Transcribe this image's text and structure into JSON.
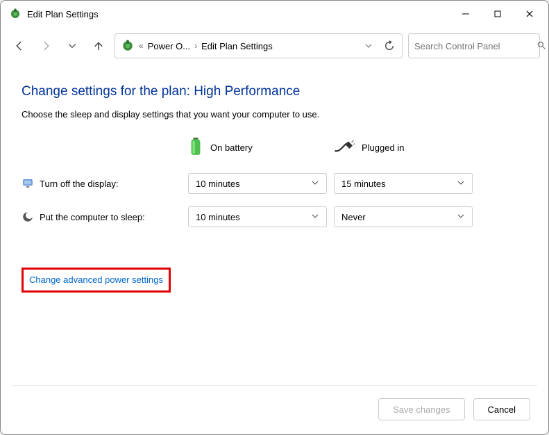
{
  "window": {
    "title": "Edit Plan Settings"
  },
  "breadcrumb": {
    "part1": "Power O...",
    "part2": "Edit Plan Settings"
  },
  "search": {
    "placeholder": "Search Control Panel"
  },
  "page": {
    "heading": "Change settings for the plan: High Performance",
    "subtext": "Choose the sleep and display settings that you want your computer to use."
  },
  "columns": {
    "battery": "On battery",
    "plugged": "Plugged in"
  },
  "settings": {
    "display": {
      "label": "Turn off the display:",
      "battery": "10 minutes",
      "plugged": "15 minutes"
    },
    "sleep": {
      "label": "Put the computer to sleep:",
      "battery": "10 minutes",
      "plugged": "Never"
    }
  },
  "link": {
    "advanced": "Change advanced power settings"
  },
  "footer": {
    "save": "Save changes",
    "cancel": "Cancel"
  }
}
